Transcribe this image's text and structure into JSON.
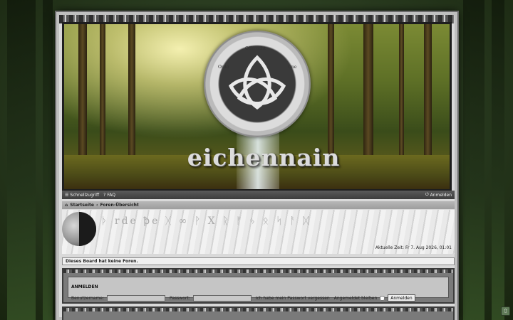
{
  "banner": {
    "logo_text": "eichennain",
    "emblem_words": [
      "Ordo",
      "Offerecht",
      "One",
      "Paganwitch",
      "Witanctr"
    ]
  },
  "navbar": {
    "quicklinks_label": "Schnellzugriff",
    "faq_label": "FAQ",
    "login_label": "Anmelden"
  },
  "breadcrumb": {
    "home_label": "Startseite",
    "separator": "‹",
    "forum_index_label": "Foren-Übersicht"
  },
  "header": {
    "runes_text": "ᚦ rde ꝥe ᚷ ∞ ᚹ X ᚱ ᚠ ᛃ ᛟ ᛋ ᚨ ᛞ",
    "current_time": "Aktuelle Zeit: Fr 7. Aug 2026, 01:01"
  },
  "notice": {
    "text": "Dieses Board hat keine Foren."
  },
  "login": {
    "title": "ANMELDEN",
    "username_label": "Benutzername:",
    "username_value": "",
    "password_label": "Passwort:",
    "password_value": "",
    "forgot_label": "Ich habe mein Passwort vergessen",
    "remember_label": "Angemeldet bleiben",
    "remember_checked": false,
    "submit_label": "Anmelden"
  },
  "scroll_top": {
    "icon": "arrow-up-icon",
    "glyph": "⇧"
  },
  "colors": {
    "navbar": "#3c3c3c",
    "breadcrumb": "#9d9d9d",
    "panel": "#7a7a7a"
  }
}
